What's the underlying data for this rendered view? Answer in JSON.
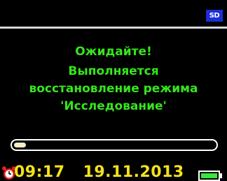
{
  "status_icons": {
    "sd_card_label": "SD",
    "sd_card_icon": "sd-card-icon"
  },
  "message": {
    "title": "Ожидайте!",
    "line1": "Выполняется",
    "line2": "восстановление режима",
    "line3": "'Исследование'"
  },
  "progress": {
    "fraction": 0.06
  },
  "status_bar": {
    "alarm_icon": "alarm-clock-icon",
    "time": "09:17",
    "date": "19.11.2013",
    "battery_icon": "battery-icon",
    "battery_level": 1.0
  },
  "colors": {
    "message_text": "#35e61c",
    "status_text": "#f3e21a",
    "sd_badge": "#1a2fd8",
    "progress_fill": "#f6ecc6",
    "battery_fill": "#3be53b",
    "alarm_icon": "#e02020"
  }
}
